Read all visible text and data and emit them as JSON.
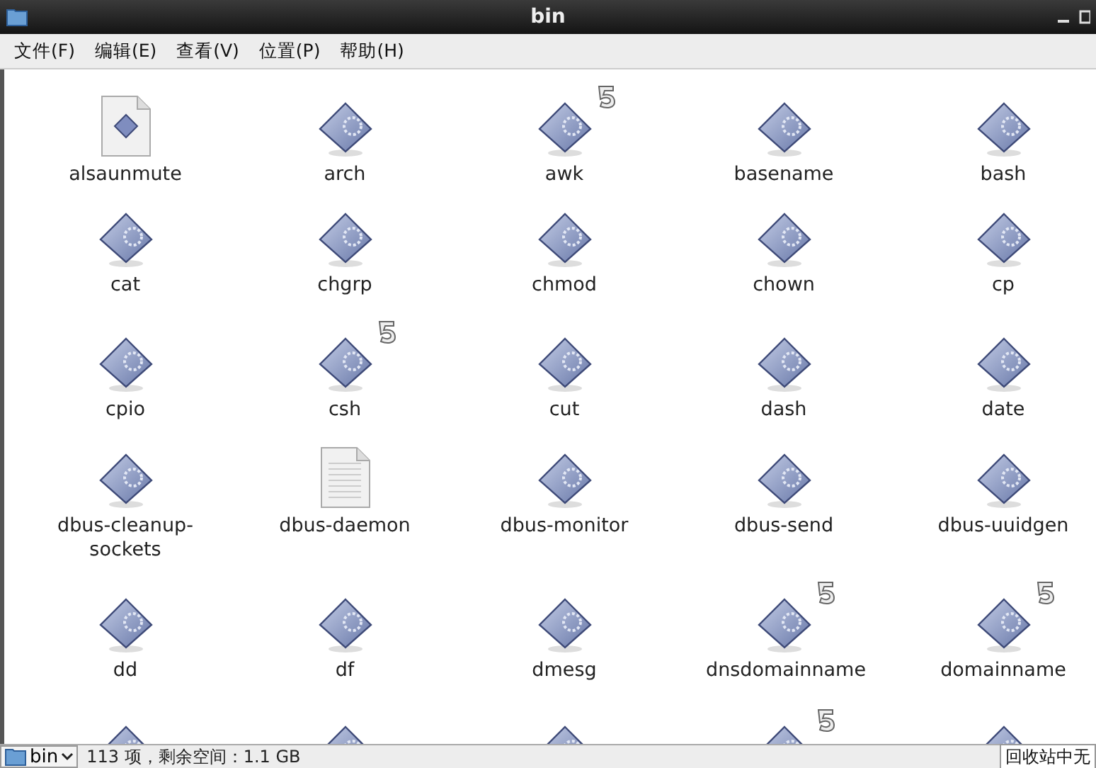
{
  "window": {
    "title": "bin"
  },
  "menu": [
    {
      "label": "文件(F)"
    },
    {
      "label": "编辑(E)"
    },
    {
      "label": "查看(V)"
    },
    {
      "label": "位置(P)"
    },
    {
      "label": "帮助(H)"
    }
  ],
  "files": [
    {
      "label": "alsaunmute",
      "kind": "script",
      "symlink": false
    },
    {
      "label": "arch",
      "kind": "executable",
      "symlink": false
    },
    {
      "label": "awk",
      "kind": "executable",
      "symlink": true
    },
    {
      "label": "basename",
      "kind": "executable",
      "symlink": false
    },
    {
      "label": "bash",
      "kind": "executable",
      "symlink": false
    },
    {
      "label": "cat",
      "kind": "executable",
      "symlink": false
    },
    {
      "label": "chgrp",
      "kind": "executable",
      "symlink": false
    },
    {
      "label": "chmod",
      "kind": "executable",
      "symlink": false
    },
    {
      "label": "chown",
      "kind": "executable",
      "symlink": false
    },
    {
      "label": "cp",
      "kind": "executable",
      "symlink": false
    },
    {
      "label": "cpio",
      "kind": "executable",
      "symlink": false
    },
    {
      "label": "csh",
      "kind": "executable",
      "symlink": true
    },
    {
      "label": "cut",
      "kind": "executable",
      "symlink": false
    },
    {
      "label": "dash",
      "kind": "executable",
      "symlink": false
    },
    {
      "label": "date",
      "kind": "executable",
      "symlink": false
    },
    {
      "label": "dbus-cleanup-sockets",
      "kind": "executable",
      "symlink": false
    },
    {
      "label": "dbus-daemon",
      "kind": "text",
      "symlink": false
    },
    {
      "label": "dbus-monitor",
      "kind": "executable",
      "symlink": false
    },
    {
      "label": "dbus-send",
      "kind": "executable",
      "symlink": false
    },
    {
      "label": "dbus-uuidgen",
      "kind": "executable",
      "symlink": false
    },
    {
      "label": "dd",
      "kind": "executable",
      "symlink": false
    },
    {
      "label": "df",
      "kind": "executable",
      "symlink": false
    },
    {
      "label": "dmesg",
      "kind": "executable",
      "symlink": false
    },
    {
      "label": "dnsdomainname",
      "kind": "executable",
      "symlink": true
    },
    {
      "label": "domainname",
      "kind": "executable",
      "symlink": true
    }
  ],
  "partial_row": [
    {
      "kind": "executable",
      "symlink": false
    },
    {
      "kind": "executable",
      "symlink": false
    },
    {
      "kind": "executable",
      "symlink": false
    },
    {
      "kind": "executable",
      "symlink": true
    },
    {
      "kind": "executable",
      "symlink": false
    }
  ],
  "status_bar": {
    "location": "bin",
    "summary": "113 项，剩余空间：1.1 GB",
    "trash": "回收站中无"
  }
}
